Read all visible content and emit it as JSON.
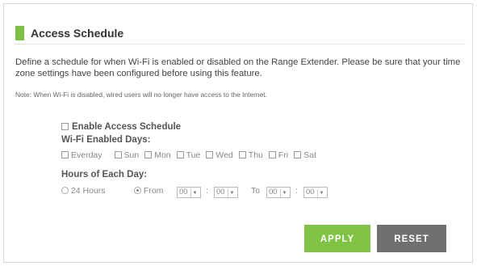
{
  "header": {
    "title": "Access Schedule"
  },
  "description": "Define a schedule for when Wi-Fi is enabled or disabled on the Range Extender. Please be sure that your time zone settings have been configured before using this feature.",
  "note": "Note: When Wi-Fi is disabled, wired users will no longer have access to the Internet.",
  "enable": {
    "label": "Enable Access Schedule",
    "checked": false
  },
  "days": {
    "title": "Wi-Fi Enabled Days:",
    "items": [
      "Everday",
      "Sun",
      "Mon",
      "Tue",
      "Wed",
      "Thu",
      "Fri",
      "Sat"
    ]
  },
  "hours": {
    "title": "Hours of Each Day:",
    "option_24": "24 Hours",
    "option_from": "From",
    "to_label": "To",
    "separator": ":",
    "from_hour": "00",
    "from_min": "00",
    "to_hour": "00",
    "to_min": "00",
    "selected": "From"
  },
  "buttons": {
    "apply": "APPLY",
    "reset": "RESET"
  },
  "colors": {
    "accent": "#7bbf44",
    "reset": "#707070"
  }
}
